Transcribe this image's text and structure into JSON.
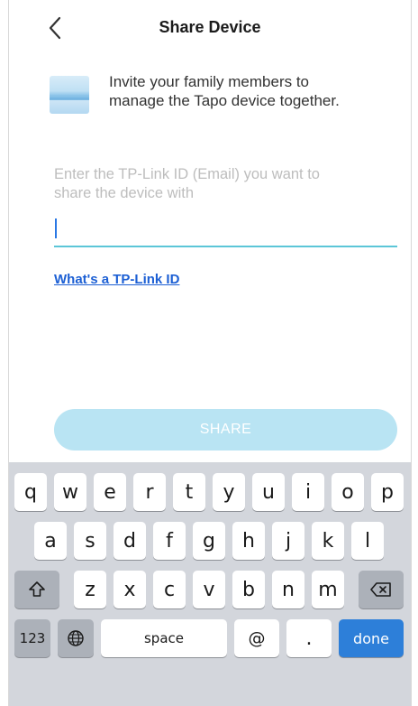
{
  "header": {
    "title": "Share Device"
  },
  "intro": {
    "line1": "Invite your family members to",
    "line2": "manage the Tapo device together."
  },
  "email_field": {
    "placeholder_line1": "Enter the TP-Link ID (Email) you want to",
    "placeholder_line2": "share the device with",
    "value": ""
  },
  "help_link": "What's a TP-Link ID",
  "share_button": "SHARE",
  "colors": {
    "accent": "#5cc6d8",
    "button_disabled": "#b9e4f3",
    "link": "#1c5fd4",
    "keyboard_bg": "#d3d6dc",
    "done_key": "#2d7fd9"
  },
  "keyboard": {
    "row1": [
      "q",
      "w",
      "e",
      "r",
      "t",
      "y",
      "u",
      "i",
      "o",
      "p"
    ],
    "row2": [
      "a",
      "s",
      "d",
      "f",
      "g",
      "h",
      "j",
      "k",
      "l"
    ],
    "row3": [
      "z",
      "x",
      "c",
      "v",
      "b",
      "n",
      "m"
    ],
    "numbers": "123",
    "space": "space",
    "at": "@",
    "dot": ".",
    "done": "done"
  }
}
